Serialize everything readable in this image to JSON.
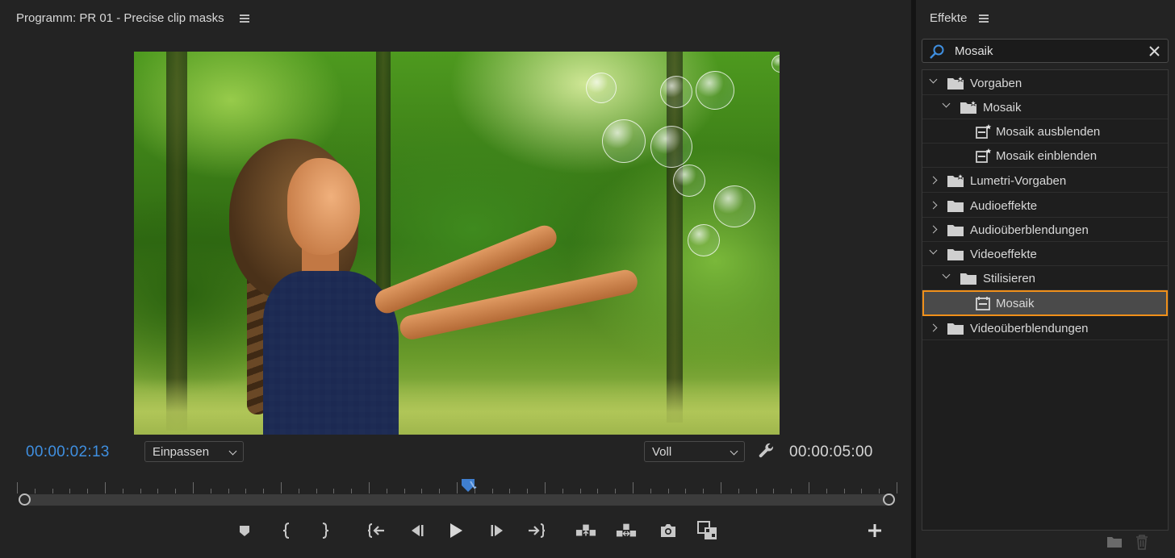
{
  "program": {
    "title": "Programm: PR 01 - Precise clip masks",
    "timecode_current": "00:00:02:13",
    "timecode_duration": "00:00:05:00",
    "fit_dropdown": "Einpassen",
    "quality_dropdown": "Voll",
    "accent_color": "#3f8fe0"
  },
  "effects": {
    "title": "Effekte",
    "search_value": "Mosaik",
    "tree": [
      {
        "label": "Vorgaben",
        "kind": "preset-folder",
        "depth": 0,
        "state": "open"
      },
      {
        "label": "Mosaik",
        "kind": "preset-folder",
        "depth": 1,
        "state": "open"
      },
      {
        "label": "Mosaik ausblenden",
        "kind": "preset-item",
        "depth": 2,
        "state": "leaf"
      },
      {
        "label": "Mosaik einblenden",
        "kind": "preset-item",
        "depth": 2,
        "state": "leaf"
      },
      {
        "label": "Lumetri-Vorgaben",
        "kind": "preset-folder",
        "depth": 0,
        "state": "closed"
      },
      {
        "label": "Audioeffekte",
        "kind": "folder",
        "depth": 0,
        "state": "closed"
      },
      {
        "label": "Audioüberblendungen",
        "kind": "folder",
        "depth": 0,
        "state": "closed"
      },
      {
        "label": "Videoeffekte",
        "kind": "folder",
        "depth": 0,
        "state": "open"
      },
      {
        "label": "Stilisieren",
        "kind": "folder",
        "depth": 1,
        "state": "open"
      },
      {
        "label": "Mosaik",
        "kind": "effect",
        "depth": 2,
        "state": "leaf",
        "selected": true
      },
      {
        "label": "Videoüberblendungen",
        "kind": "folder",
        "depth": 0,
        "state": "closed"
      }
    ],
    "highlight_color": "#f0901a"
  },
  "playhead_fraction": 0.52
}
